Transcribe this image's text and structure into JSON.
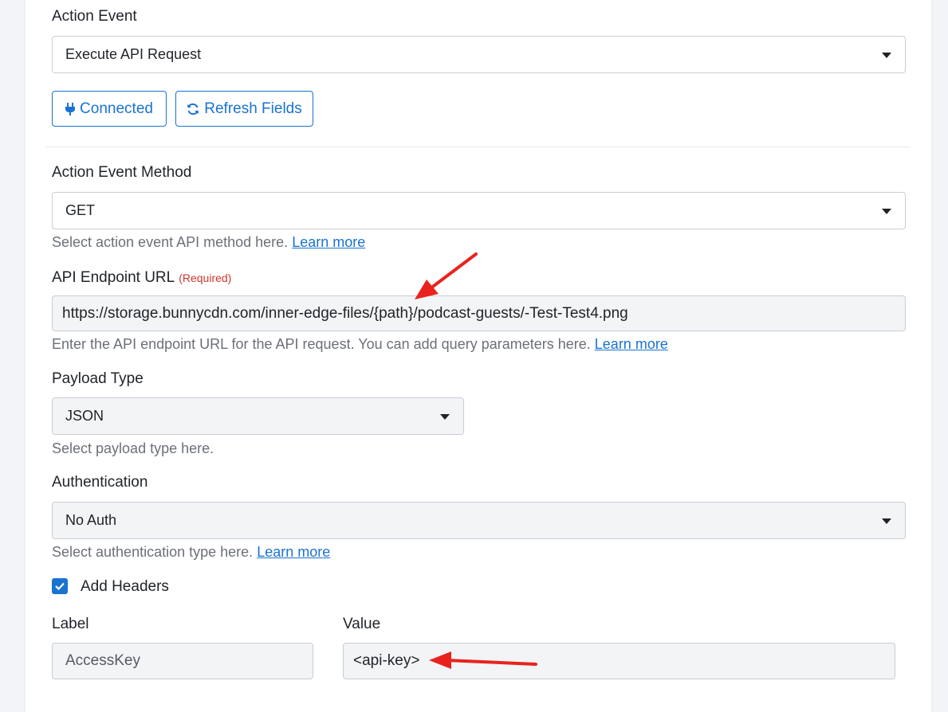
{
  "action_event": {
    "label": "Action Event",
    "value": "Execute API Request"
  },
  "buttons": {
    "connected": "Connected",
    "refresh": "Refresh Fields"
  },
  "method": {
    "label": "Action Event Method",
    "value": "GET",
    "help": "Select action event API method here.",
    "link": "Learn more"
  },
  "endpoint": {
    "label": "API Endpoint URL",
    "required": "(Required)",
    "value": "https://storage.bunnycdn.com/inner-edge-files/{path}/podcast-guests/-Test-Test4.png",
    "help": "Enter the API endpoint URL for the API request. You can add query parameters here.",
    "link": "Learn more"
  },
  "payload": {
    "label": "Payload Type",
    "value": "JSON",
    "help": "Select payload type here."
  },
  "auth": {
    "label": "Authentication",
    "value": "No Auth",
    "help": "Select authentication type here.",
    "link": "Learn more"
  },
  "headers": {
    "checkbox_label": "Add Headers",
    "checked": true,
    "label_col": "Label",
    "value_col": "Value",
    "rows": [
      {
        "label": "AccessKey",
        "value": "<api-key>"
      }
    ]
  },
  "colors": {
    "accent": "#1a73d0",
    "required": "#d0352b",
    "annotation_arrow": "#e8231e"
  },
  "icons": {
    "connected": "plug-icon",
    "refresh": "refresh-icon",
    "dropdown": "caret-down-icon",
    "check": "check-icon"
  }
}
